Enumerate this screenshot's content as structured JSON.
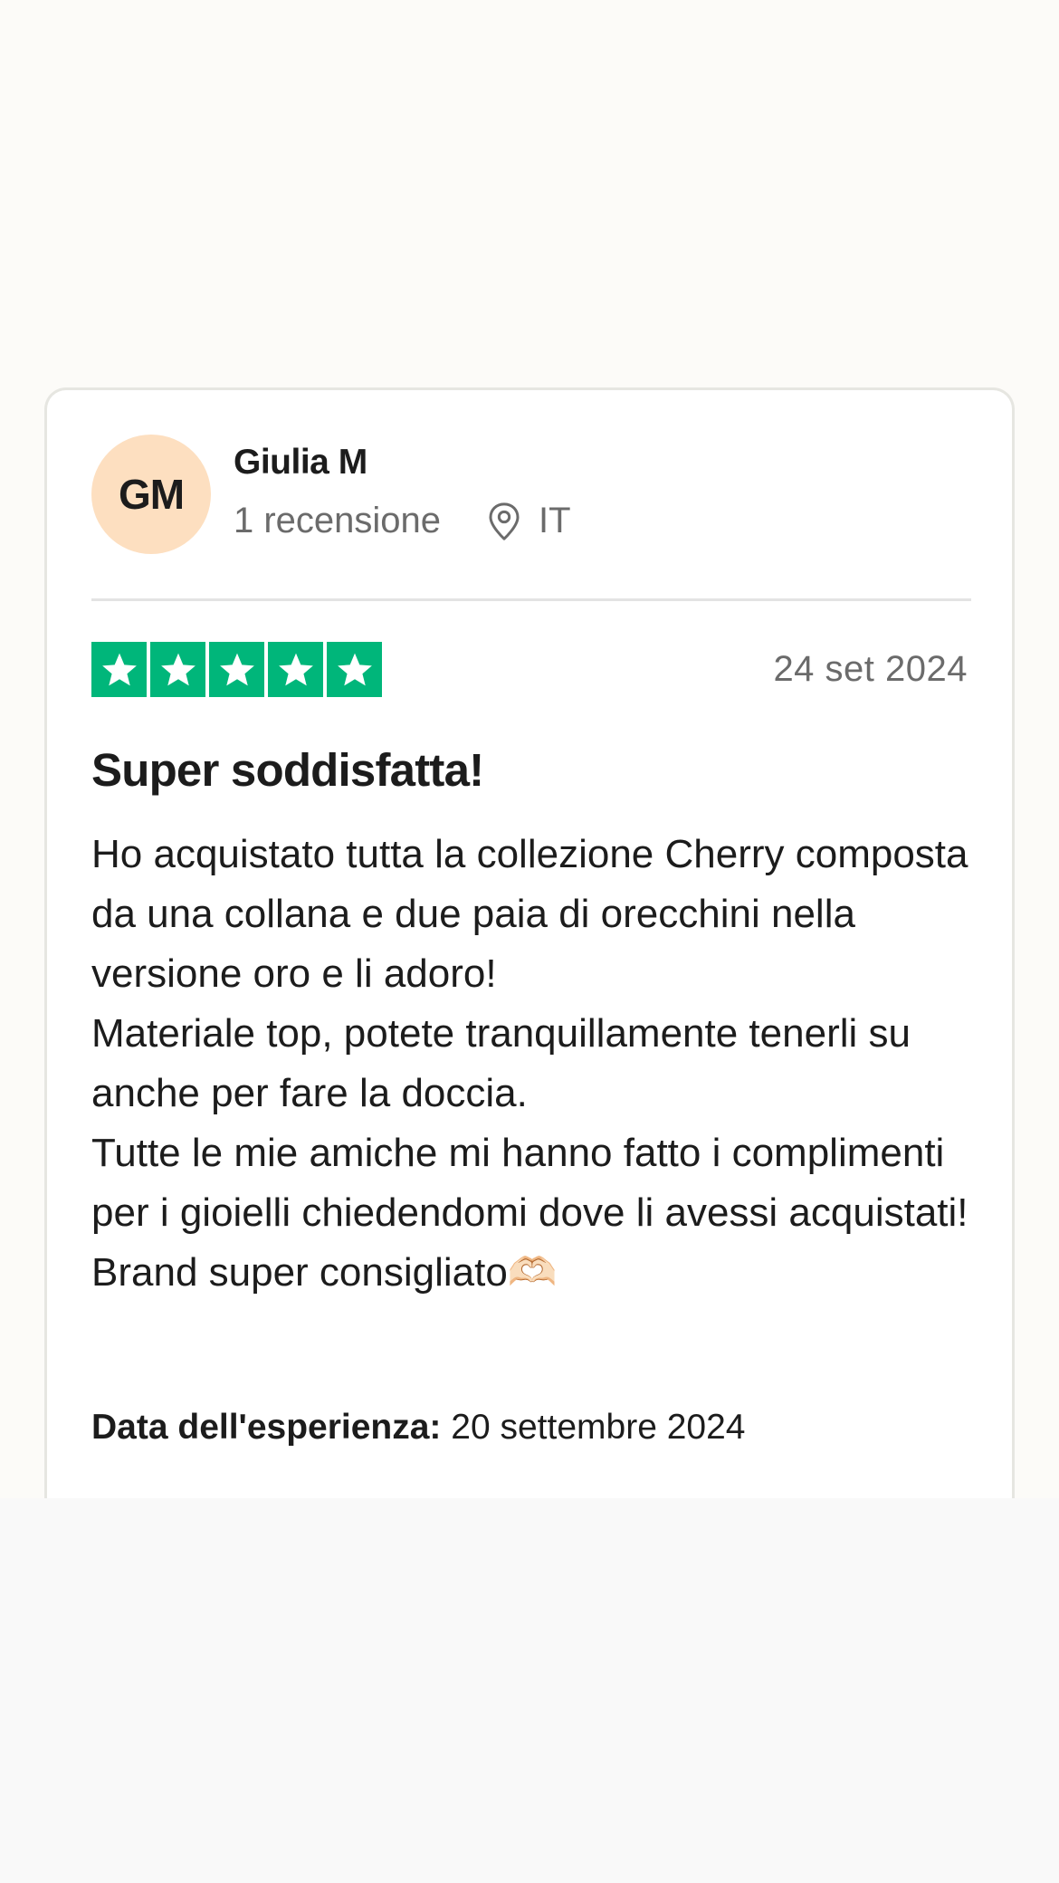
{
  "reviewer": {
    "initials": "GM",
    "name": "Giulia M",
    "review_count": "1 recensione",
    "country": "IT"
  },
  "review": {
    "rating": 5,
    "rating_max": 5,
    "date": "24 set 2024",
    "title": "Super soddisfatta!",
    "body": "Ho acquistato tutta la collezione Cherry composta da una collana e due paia di orecchini nella versione oro e li adoro!\nMateriale top, potete tranquillamente tenerli su anche per fare la doccia.\nTutte le mie amiche mi hanno fatto i complimenti per i gioielli chiedendomi dove li avessi acquistati!\nBrand super consigliato🫶🏻",
    "experience_label": "Data dell'esperienza:",
    "experience_date": "20 settembre 2024"
  },
  "icons": {
    "location": "map-pin-icon",
    "rating": "star-icon"
  },
  "colors": {
    "star_green": "#00b67a",
    "avatar_bg": "#fddfc0",
    "muted_text": "#6b6b6b"
  }
}
